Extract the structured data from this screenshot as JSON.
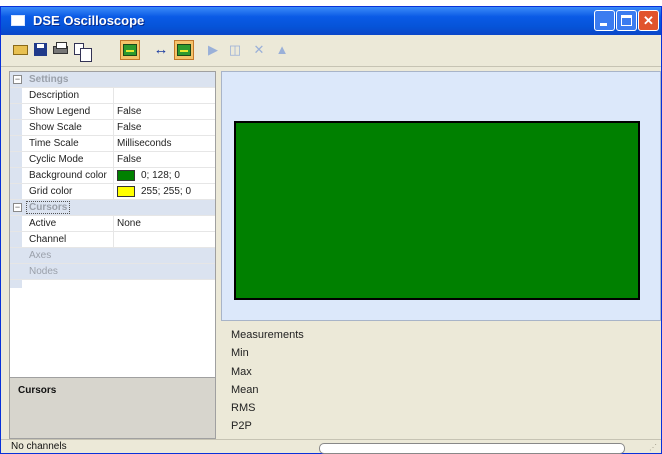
{
  "window": {
    "title": "DSE Oscilloscope",
    "buttons": {
      "minimize": "minimize",
      "maximize": "maximize",
      "close": "close"
    }
  },
  "toolbar": {
    "items": [
      {
        "icon": "open-icon",
        "enabled": true
      },
      {
        "icon": "save-icon",
        "enabled": true
      },
      {
        "icon": "print-icon",
        "enabled": true
      },
      {
        "icon": "copy-icon",
        "enabled": true
      },
      {
        "icon": "scope-icon",
        "enabled": true,
        "toggled": true
      },
      {
        "icon": "horizontal-arrows-icon",
        "enabled": true
      },
      {
        "icon": "scope-icon",
        "enabled": true,
        "toggled": true
      },
      {
        "icon": "play-icon",
        "enabled": false
      },
      {
        "icon": "stop-icon",
        "enabled": false
      },
      {
        "icon": "delete-icon",
        "enabled": false
      },
      {
        "icon": "eject-icon",
        "enabled": false
      }
    ]
  },
  "properties": {
    "settings_category": "Settings",
    "settings": [
      {
        "name": "Description",
        "value": ""
      },
      {
        "name": "Show Legend",
        "value": "False"
      },
      {
        "name": "Show Scale",
        "value": "False"
      },
      {
        "name": "Time Scale",
        "value": "Milliseconds"
      },
      {
        "name": "Cyclic Mode",
        "value": "False"
      },
      {
        "name": "Background color",
        "value": "0; 128; 0",
        "swatch": "#008000"
      },
      {
        "name": "Grid color",
        "value": "255; 255; 0",
        "swatch": "#ffff00"
      }
    ],
    "cursors_category": "Cursors",
    "cursors": [
      {
        "name": "Active",
        "value": "None"
      },
      {
        "name": "Channel",
        "value": ""
      }
    ],
    "disabled_items": [
      "Axes",
      "Nodes"
    ]
  },
  "description_panel": {
    "title": "Cursors"
  },
  "scope": {
    "background_color": "#008000"
  },
  "measurements": {
    "header": "Measurements",
    "items": [
      "Min",
      "Max",
      "Mean",
      "RMS",
      "P2P"
    ]
  },
  "status": {
    "text": "No channels"
  },
  "colors": {
    "titlebar": "#0a5ae6",
    "scope_bg": "#008000",
    "panel_bg": "#dce8fa",
    "chrome": "#ece9d8"
  }
}
